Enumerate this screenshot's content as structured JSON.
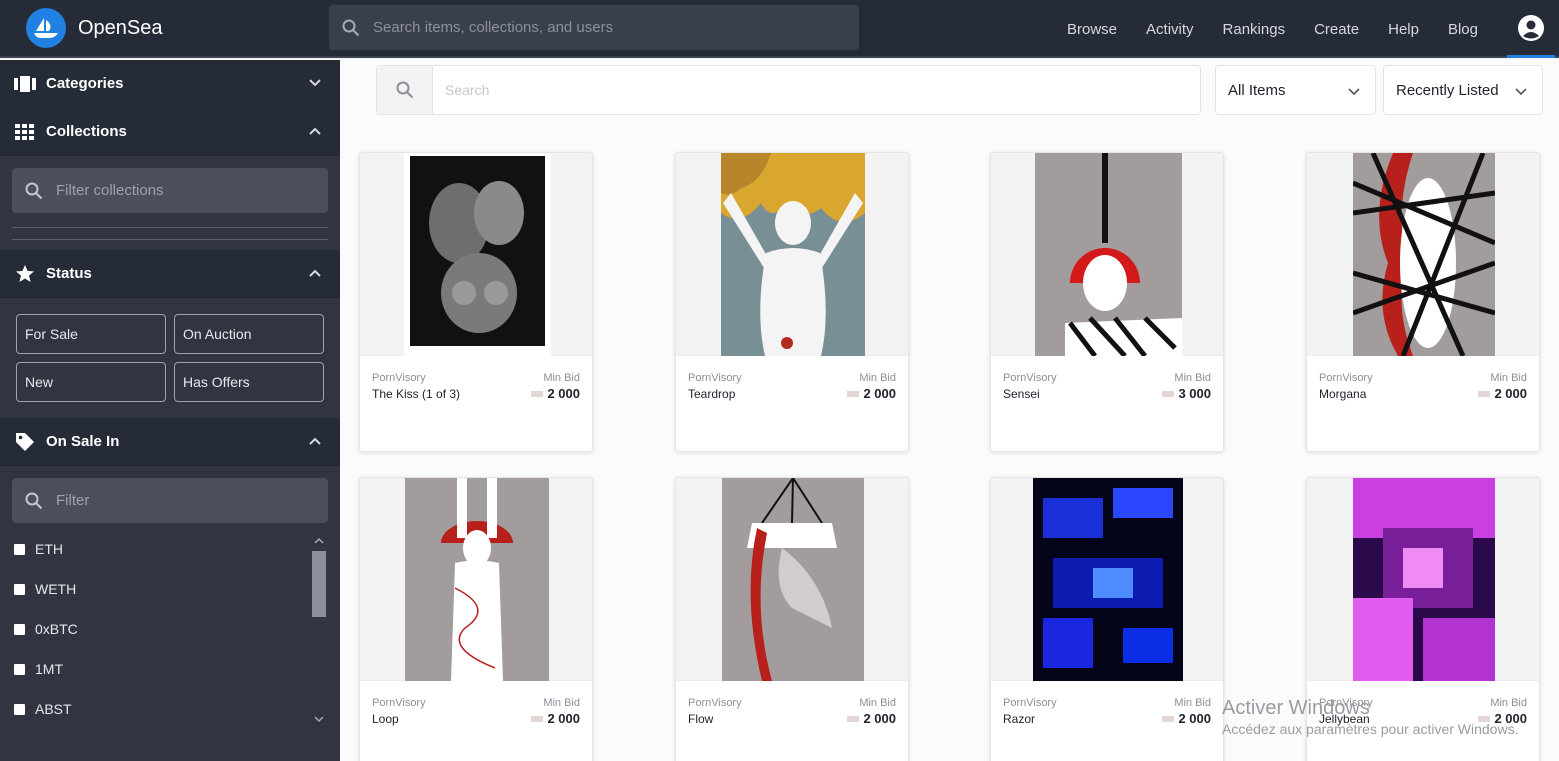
{
  "brand": {
    "name": "OpenSea"
  },
  "topnav": {
    "search_placeholder": "Search items, collections, and users",
    "links": [
      "Browse",
      "Activity",
      "Rankings",
      "Create",
      "Help",
      "Blog"
    ]
  },
  "sidebar": {
    "categories": {
      "label": "Categories"
    },
    "collections": {
      "label": "Collections",
      "filter_placeholder": "Filter collections"
    },
    "status": {
      "label": "Status",
      "buttons": [
        "For Sale",
        "On Auction",
        "New",
        "Has Offers"
      ]
    },
    "on_sale_in": {
      "label": "On Sale In",
      "filter_placeholder": "Filter",
      "tokens": [
        "ETH",
        "WETH",
        "0xBTC",
        "1MT",
        "ABST"
      ]
    }
  },
  "main": {
    "search_placeholder": "Search",
    "items_filter": "All Items",
    "sort": "Recently Listed",
    "cards": [
      {
        "collection": "PornVisory",
        "name": "The Kiss (1 of 3)",
        "bid_label": "Min Bid",
        "price": "2 000"
      },
      {
        "collection": "PornVisory",
        "name": "Teardrop",
        "bid_label": "Min Bid",
        "price": "2 000"
      },
      {
        "collection": "PornVisory",
        "name": "Sensei",
        "bid_label": "Min Bid",
        "price": "3 000"
      },
      {
        "collection": "PornVisory",
        "name": "Morgana",
        "bid_label": "Min Bid",
        "price": "2 000"
      },
      {
        "collection": "PornVisory",
        "name": "Loop",
        "bid_label": "Min Bid",
        "price": "2 000"
      },
      {
        "collection": "PornVisory",
        "name": "Flow",
        "bid_label": "Min Bid",
        "price": "2 000"
      },
      {
        "collection": "PornVisory",
        "name": "Razor",
        "bid_label": "Min Bid",
        "price": "2 000"
      },
      {
        "collection": "PornVisory",
        "name": "Jellybean",
        "bid_label": "Min Bid",
        "price": "2 000"
      }
    ]
  },
  "watermark": {
    "title": "Activer Windows",
    "subtitle": "Accédez aux paramètres pour activer Windows."
  },
  "colors": {
    "topbar": "#262b38",
    "sidebar": "#303541",
    "accent": "#2081e2"
  }
}
